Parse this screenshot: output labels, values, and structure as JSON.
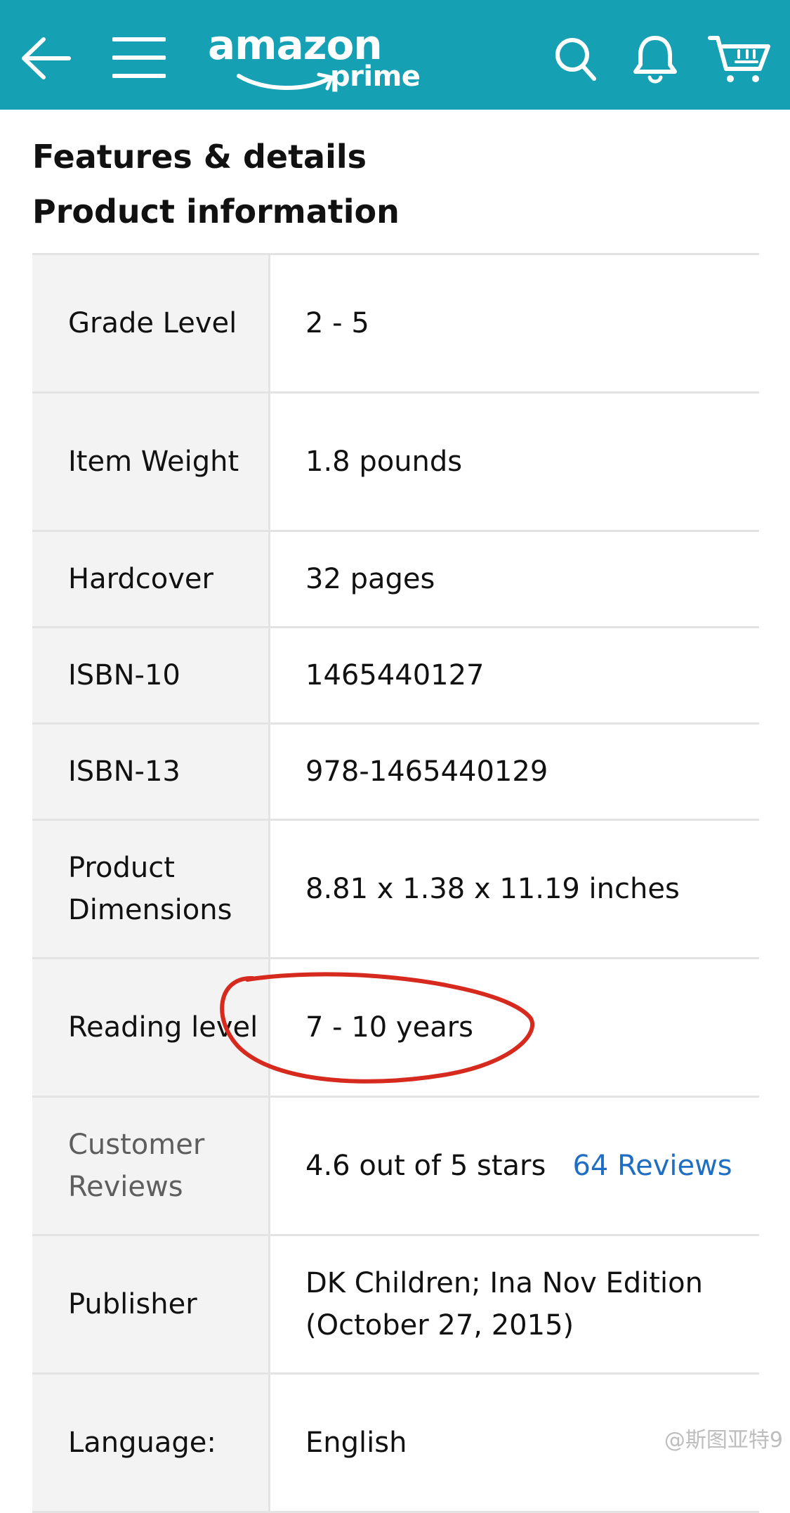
{
  "header": {
    "brand": "amazon",
    "brand_sub": "prime",
    "bg_color": "#15a0b4",
    "icons": [
      "back-arrow-icon",
      "hamburger-menu-icon",
      "search-icon",
      "bell-icon",
      "cart-icon"
    ]
  },
  "section": {
    "title1": "Features & details",
    "title2": "Product information"
  },
  "table": {
    "rows": [
      {
        "label": "Grade Level",
        "value": "2 - 5"
      },
      {
        "label": "Item Weight",
        "value": "1.8 pounds"
      },
      {
        "label": "Hardcover",
        "value": "32 pages"
      },
      {
        "label": "ISBN-10",
        "value": "1465440127"
      },
      {
        "label": "ISBN-13",
        "value": "978-1465440129"
      },
      {
        "label": "Product Dimensions",
        "value": "8.81 x 1.38 x 11.19 inches"
      },
      {
        "label": "Reading level",
        "value": "7 - 10 years"
      },
      {
        "label": "Customer Reviews",
        "value": "4.6 out of 5 stars",
        "link": "64 Reviews"
      },
      {
        "label": "Publisher",
        "value": "DK Children; Ina Nov Edition (October 27, 2015)"
      },
      {
        "label": "Language:",
        "value": "English"
      }
    ]
  },
  "annotation": {
    "color": "#d62a1e"
  },
  "watermark": "@斯图亚特9"
}
